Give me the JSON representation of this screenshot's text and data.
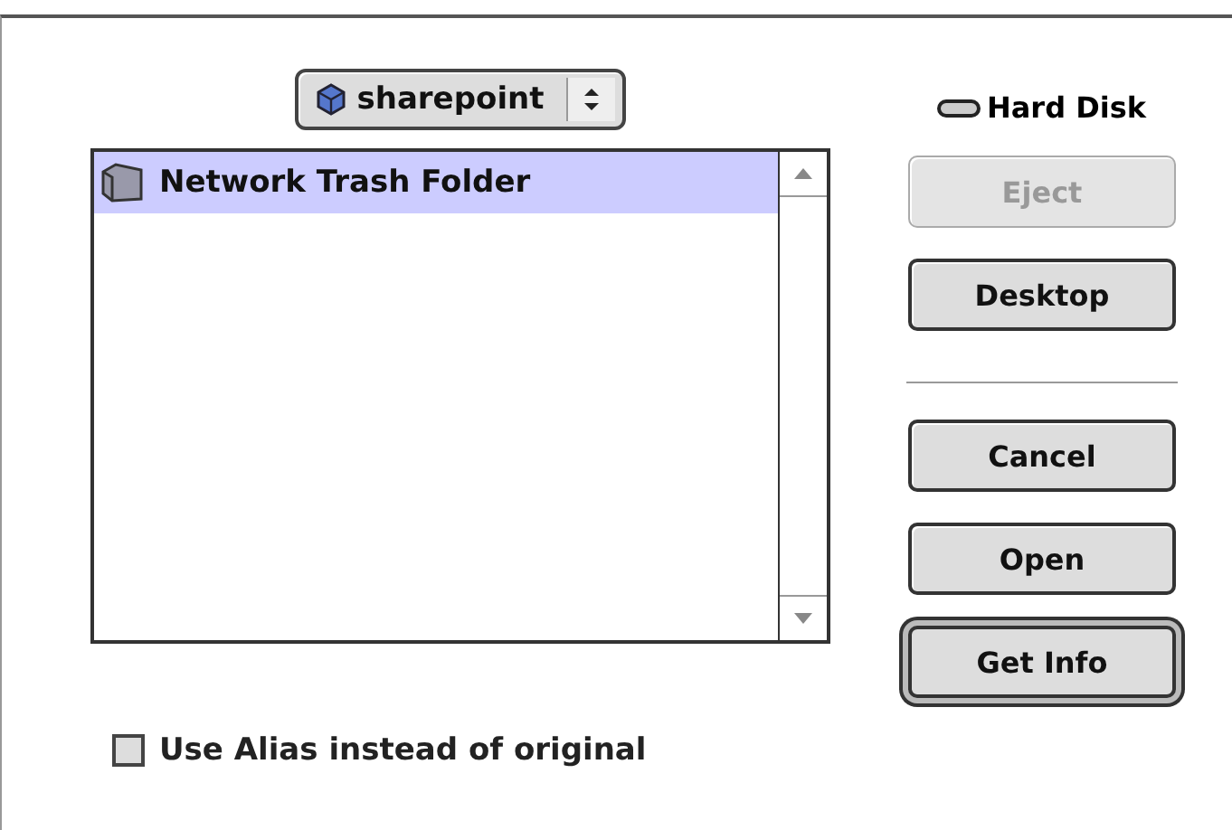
{
  "location_popup": {
    "label": "sharepoint"
  },
  "files": [
    {
      "name": "Network Trash Folder",
      "selected": true
    }
  ],
  "volume": {
    "name": "Hard Disk"
  },
  "top_buttons": [
    {
      "label": "Eject",
      "disabled": true,
      "default": false
    },
    {
      "label": "Desktop",
      "disabled": false,
      "default": false
    }
  ],
  "bottom_buttons": [
    {
      "label": "Cancel",
      "disabled": false,
      "default": false
    },
    {
      "label": "Open",
      "disabled": false,
      "default": false
    },
    {
      "label": "Get Info",
      "disabled": false,
      "default": true
    }
  ],
  "alias_checkbox": {
    "label": "Use Alias instead of original",
    "checked": false
  }
}
